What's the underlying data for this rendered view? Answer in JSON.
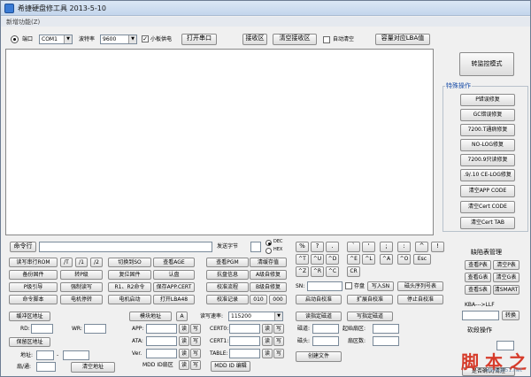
{
  "window": {
    "title": "希捷硬盘修工具 2013-5-10"
  },
  "menu": {
    "item": "新增功能(Z)"
  },
  "toolbar": {
    "port_label": "端口",
    "port_value": "COM1",
    "baud_label": "波特率",
    "baud_value": "9600",
    "power_label": "小板供电",
    "open_port": "打开串口",
    "recv_area": "接收区",
    "clear_recv": "清空接收区",
    "auto_clear": "自动清空",
    "capacity_lba": "容量对应LBA值"
  },
  "right_panel": {
    "monitor_button": "转监控模式",
    "special_title": "特殊操作",
    "special_buttons": [
      "P错误修复",
      "GC错误修复",
      "7200.T通病修复",
      "NO-LOG修复",
      "7200.9只读修复",
      ".9/.10 CE-LOG修复",
      "清空APP CODE",
      "清空Cert CODE",
      "清空Cert TAB"
    ]
  },
  "command_row": {
    "label": "命令行",
    "send_label": "发送字节",
    "dec": "DEC",
    "hex": "HEX"
  },
  "left_grid": [
    [
      "读写串行ROM",
      "/T",
      "/1",
      "/2",
      "切换到SO",
      "查看AGE",
      "查看PGM",
      "清缓存值"
    ],
    [
      "备份固件",
      "转P级",
      "复位固件",
      "认盘",
      "抗盘信息",
      "A级自修复"
    ],
    [
      "P级引导",
      "强制读写",
      "R1、R2命令",
      "保存APP.CERT",
      "校准流程",
      "B级自修复"
    ],
    [
      "命令脚本",
      "电机停转",
      "电机启动",
      "打开LBA48",
      "校准记录",
      "010",
      "000"
    ]
  ],
  "keys": {
    "row1": [
      "%",
      "?",
      ".",
      "`",
      "'",
      ";",
      ":",
      "^",
      "!"
    ],
    "row2": [
      "^T",
      "^U",
      "^D",
      "^E",
      "^L",
      "^A",
      "^O",
      "Esc"
    ],
    "row3": [
      "^Z",
      "^R",
      "^C",
      "CR"
    ]
  },
  "sn_row": {
    "label": "SN:",
    "save": "存盘",
    "write_sn": "写入SN",
    "write_sn_disk": "磁头序列号表"
  },
  "auto_calib": {
    "start": "启动自校准",
    "expand": "扩展自校准",
    "stop": "停止自校准"
  },
  "defect": {
    "title": "缺陷表管理",
    "buttons": [
      "查看P表",
      "清空P表",
      "查看G表",
      "清空G表",
      "查看S表",
      "清SMART"
    ]
  },
  "bottom_left": {
    "buffer_addr": "缓冲区地址",
    "rd_label": "RD:",
    "wr_label": "WR:",
    "protect_addr": "保留区地址",
    "addr_label": "地址:",
    "sector_label": "扇/通:",
    "clear_addr": "清空地址"
  },
  "bottom_mid": {
    "module_addr": "模块地址",
    "a_button": "A",
    "app_label": "APP:",
    "ata_label": "ATA:",
    "ver_label": "Ver.",
    "read": "读",
    "write": "写",
    "mdd_label": "MDD ID扇区",
    "read_speed": "读写速率:",
    "speed_value": "115200",
    "cert0": "CERT0:",
    "cert1": "CERT1:",
    "table": "TABLE:",
    "mdd_edit": "MDD ID 编辑"
  },
  "bottom_right": {
    "read_track": "读指定磁道",
    "write_track": "写指定磁道",
    "track_label": "磁道:",
    "start_sector": "起始扇区:",
    "head_label": "磁头:",
    "sector_count": "扇区数:",
    "create_file": "创建文件",
    "kba_label": "KBA--->LLF",
    "convert": "转换",
    "fw_title": "砍段操作",
    "fw_value": "",
    "confirm": "是否确认/清理"
  },
  "watermark": {
    "text": "脚 本 之 家",
    "url": "www.jb51.net"
  }
}
